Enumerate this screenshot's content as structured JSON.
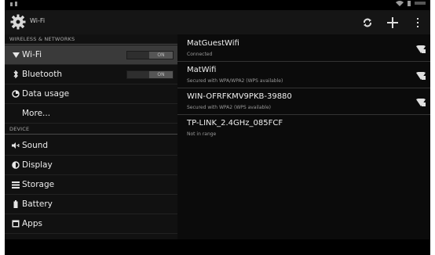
{
  "action_bar": {
    "title": "Wi-Fi"
  },
  "sections": {
    "wireless": "WIRELESS & NETWORKS",
    "device": "DEVICE"
  },
  "menu": {
    "wifi": {
      "label": "Wi-Fi",
      "toggle": "ON"
    },
    "bluetooth": {
      "label": "Bluetooth",
      "toggle": "ON"
    },
    "data_usage": {
      "label": "Data usage"
    },
    "more": {
      "label": "More..."
    },
    "sound": {
      "label": "Sound"
    },
    "display": {
      "label": "Display"
    },
    "storage": {
      "label": "Storage"
    },
    "battery": {
      "label": "Battery"
    },
    "apps": {
      "label": "Apps"
    }
  },
  "networks": [
    {
      "name": "MatGuestWifi",
      "status": "Connected"
    },
    {
      "name": "MatWifi",
      "status": "Secured with WPA/WPA2 (WPS available)"
    },
    {
      "name": "WIN-OFRFKMV9PKB-39880",
      "status": "Secured with WPA2 (WPS available)"
    },
    {
      "name": "TP-LINK_2.4GHz_085FCF",
      "status": "Not in range"
    }
  ],
  "colors": {
    "selected_row": "#3a3a3a",
    "background": "#0a0a0a"
  }
}
